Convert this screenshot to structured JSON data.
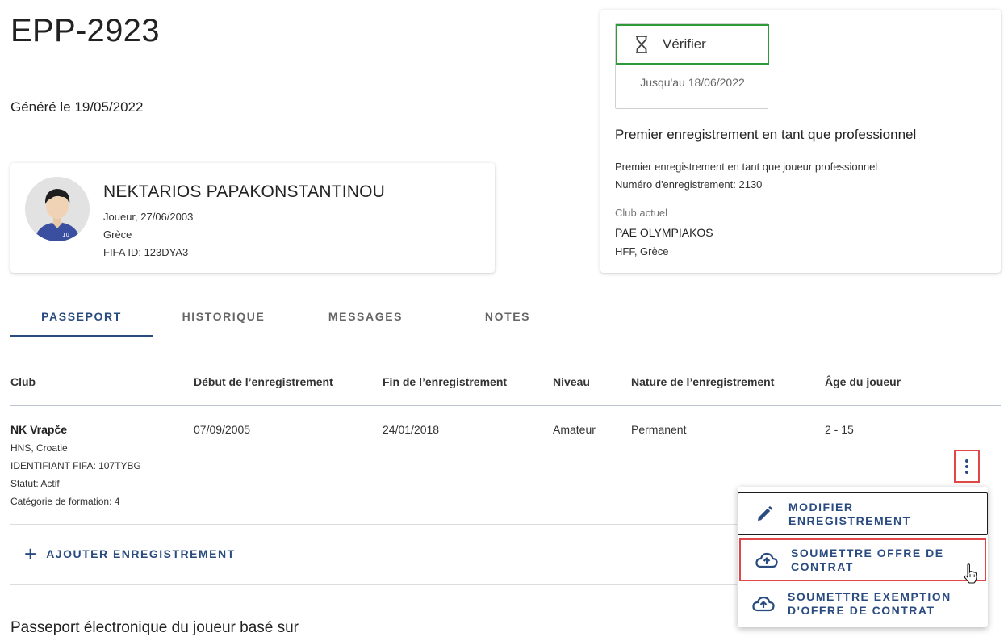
{
  "header": {
    "title": "EPP-2923",
    "generated": "Généré le 19/05/2022"
  },
  "player": {
    "name": "NEKTARIOS PAPAKONSTANTINOU",
    "role_dob": "Joueur, 27/06/2003",
    "country": "Grèce",
    "fifa_id": "FIFA ID: 123DYA3",
    "jersey_number": "10"
  },
  "status": {
    "verify_label": "Vérifier",
    "verify_until": "Jusqu'au 18/06/2022",
    "heading": "Premier enregistrement en tant que professionnel",
    "detail_1": "Premier enregistrement en tant que joueur professionnel",
    "detail_2": "Numéro d'enregistrement: 2130",
    "current_club_label": "Club actuel",
    "current_club": "PAE OLYMPIAKOS",
    "current_club_assoc": "HFF, Grèce",
    "accent_color": "#2e9a3a"
  },
  "tabs": [
    {
      "label": "PASSEPORT",
      "active": true
    },
    {
      "label": "HISTORIQUE",
      "active": false
    },
    {
      "label": "MESSAGES",
      "active": false
    },
    {
      "label": "NOTES",
      "active": false
    }
  ],
  "table": {
    "headers": [
      "Club",
      "Début de l’enregistrement",
      "Fin de l’enregistrement",
      "Niveau",
      "Nature de l’enregistrement",
      "Âge du joueur"
    ],
    "rows": [
      {
        "club": "NK Vrapče",
        "club_assoc": "HNS, Croatie",
        "club_fifa_id": "IDENTIFIANT FIFA: 107TYBG",
        "club_status": "Statut: Actif",
        "club_category": "Catégorie de formation: 4",
        "start": "07/09/2005",
        "end": "24/01/2018",
        "level": "Amateur",
        "nature": "Permanent",
        "age": "2 - 15"
      }
    ]
  },
  "add_registration": "AJOUTER ENREGISTREMENT",
  "section_title": "Passeport électronique du joueur basé sur",
  "menu": [
    {
      "label": "MODIFIER ENREGISTREMENT",
      "icon": "pencil-icon"
    },
    {
      "label": "SOUMETTRE OFFRE DE CONTRAT",
      "icon": "cloud-upload-icon"
    },
    {
      "label": "SOUMETTRE EXEMPTION D'OFFRE DE CONTRAT",
      "icon": "cloud-upload-icon"
    }
  ],
  "colors": {
    "primary": "#2a4b80",
    "highlight": "#e04848"
  }
}
